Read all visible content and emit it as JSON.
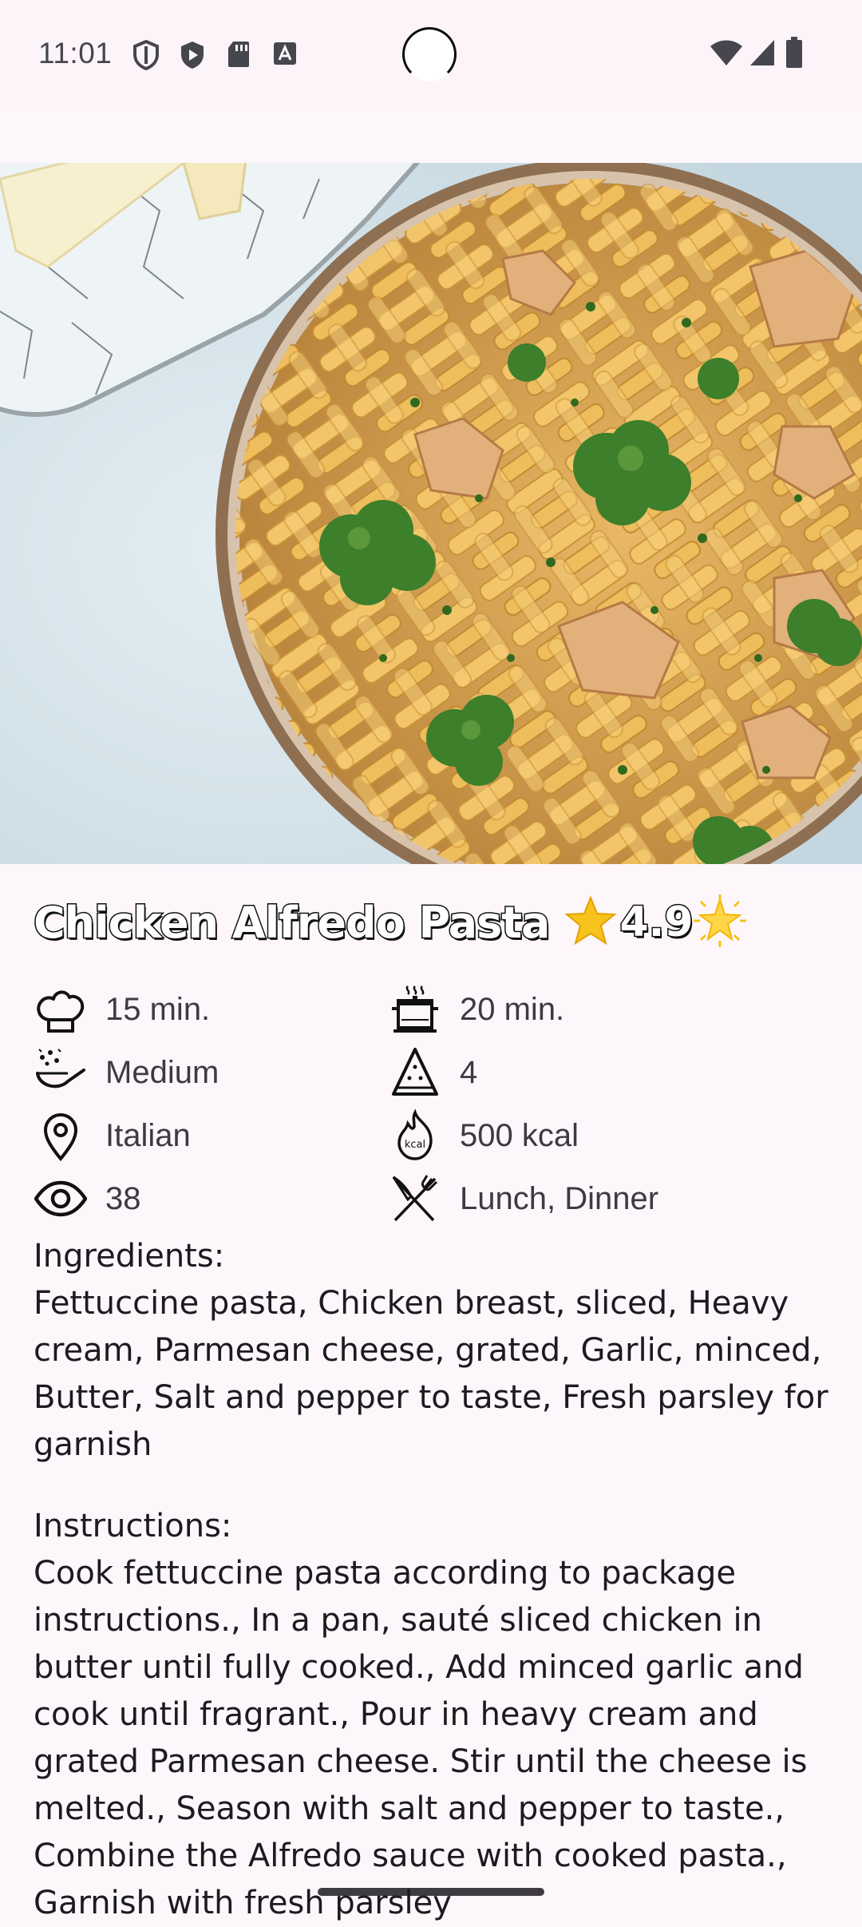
{
  "status_bar": {
    "time": "11:01",
    "left_icons": [
      "shield-outline-icon",
      "play-protect-icon",
      "sd-card-icon",
      "a-badge-icon"
    ],
    "right_icons": [
      "wifi-icon",
      "cell-signal-icon",
      "battery-icon"
    ]
  },
  "recipe": {
    "title": "Chicken Alfredo Pasta",
    "rating": "4.9",
    "rating_icons": [
      "star-icon",
      "sparkle-star-icon"
    ],
    "meta": {
      "prep_time": "15 min.",
      "cook_time": "20 min.",
      "difficulty": "Medium",
      "servings": "4",
      "cuisine": "Italian",
      "calories": "500 kcal",
      "views": "38",
      "meal_type": "Lunch, Dinner"
    },
    "ingredients_label": "Ingredients:",
    "ingredients": "Fettuccine pasta, Chicken breast, sliced, Heavy cream, Parmesan cheese, grated, Garlic, minced, Butter, Salt and pepper to taste, Fresh parsley for garnish",
    "instructions_label": "Instructions:",
    "instructions": "Cook fettuccine pasta according to package instructions., In a pan, sauté sliced chicken in butter until fully cooked., Add minced garlic and cook until fragrant., Pour in heavy cream and grated Parmesan cheese. Stir until the cheese is melted., Season with salt and pepper to taste., Combine the Alfredo sauce with cooked pasta., Garnish with fresh parsley"
  },
  "colors": {
    "background": "#fdf7fb",
    "text": "#1c1b1f",
    "meta_text": "#3d3a40",
    "star": "#f6c21c"
  }
}
